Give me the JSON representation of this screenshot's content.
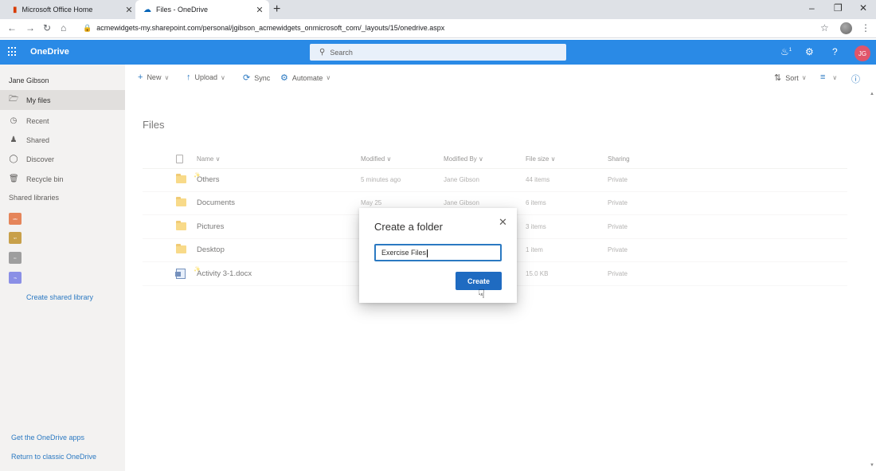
{
  "browser": {
    "tabs": [
      {
        "title": "Microsoft Office Home",
        "active": false
      },
      {
        "title": "Files - OneDrive",
        "active": true
      }
    ],
    "url": "acmewidgets-my.sharepoint.com/personal/jgibson_acmewidgets_onmicrosoft_com/_layouts/15/onedrive.aspx"
  },
  "suitebar": {
    "app_name": "OneDrive",
    "search_placeholder": "Search",
    "notification_count": "1",
    "avatar_initials": "JG",
    "colors": {
      "suitebar_bg": "#2a8ae6",
      "avatar_bg": "#e0556a"
    }
  },
  "leftnav": {
    "user_name": "Jane Gibson",
    "items": [
      {
        "label": "My files",
        "icon": "folder-icon",
        "selected": true
      },
      {
        "label": "Recent",
        "icon": "clock-icon",
        "selected": false
      },
      {
        "label": "Shared",
        "icon": "people-icon",
        "selected": false
      },
      {
        "label": "Discover",
        "icon": "compass-icon",
        "selected": false
      },
      {
        "label": "Recycle bin",
        "icon": "trash-icon",
        "selected": false
      }
    ],
    "shared_libraries_heading": "Shared libraries",
    "libraries": [
      {
        "abbr": "MM",
        "color": "#e5855a"
      },
      {
        "abbr": "ST",
        "color": "#c8a04a"
      },
      {
        "abbr": "IC",
        "color": "#9e9e9e"
      },
      {
        "abbr": "TS",
        "color": "#8a8fe6"
      }
    ],
    "create_library_label": "Create shared library",
    "bottom_links": [
      "Get the OneDrive apps",
      "Return to classic OneDrive"
    ]
  },
  "commandbar": {
    "new_label": "New",
    "upload_label": "Upload",
    "sync_label": "Sync",
    "automate_label": "Automate",
    "sort_label": "Sort"
  },
  "main": {
    "title": "Files",
    "columns": [
      "Name",
      "Modified",
      "Modified By",
      "File size",
      "Sharing"
    ],
    "rows": [
      {
        "name": "Others",
        "type": "folder",
        "modified": "5 minutes ago",
        "modified_by": "Jane Gibson",
        "size": "44 items",
        "sharing": "Private",
        "new": true
      },
      {
        "name": "Documents",
        "type": "folder",
        "modified": "May 25",
        "modified_by": "Jane Gibson",
        "size": "6 items",
        "sharing": "Private",
        "new": false
      },
      {
        "name": "Pictures",
        "type": "folder",
        "modified": "",
        "modified_by": "",
        "size": "3 items",
        "sharing": "Private",
        "new": false
      },
      {
        "name": "Desktop",
        "type": "folder",
        "modified": "",
        "modified_by": "",
        "size": "1 item",
        "sharing": "Private",
        "new": false
      },
      {
        "name": "Activity 3-1.docx",
        "type": "word-doc",
        "modified": "",
        "modified_by": "",
        "size": "15.0 KB",
        "sharing": "Private",
        "new": true
      }
    ]
  },
  "dialog": {
    "title": "Create a folder",
    "input_value": "Exercise Files",
    "create_label": "Create"
  }
}
